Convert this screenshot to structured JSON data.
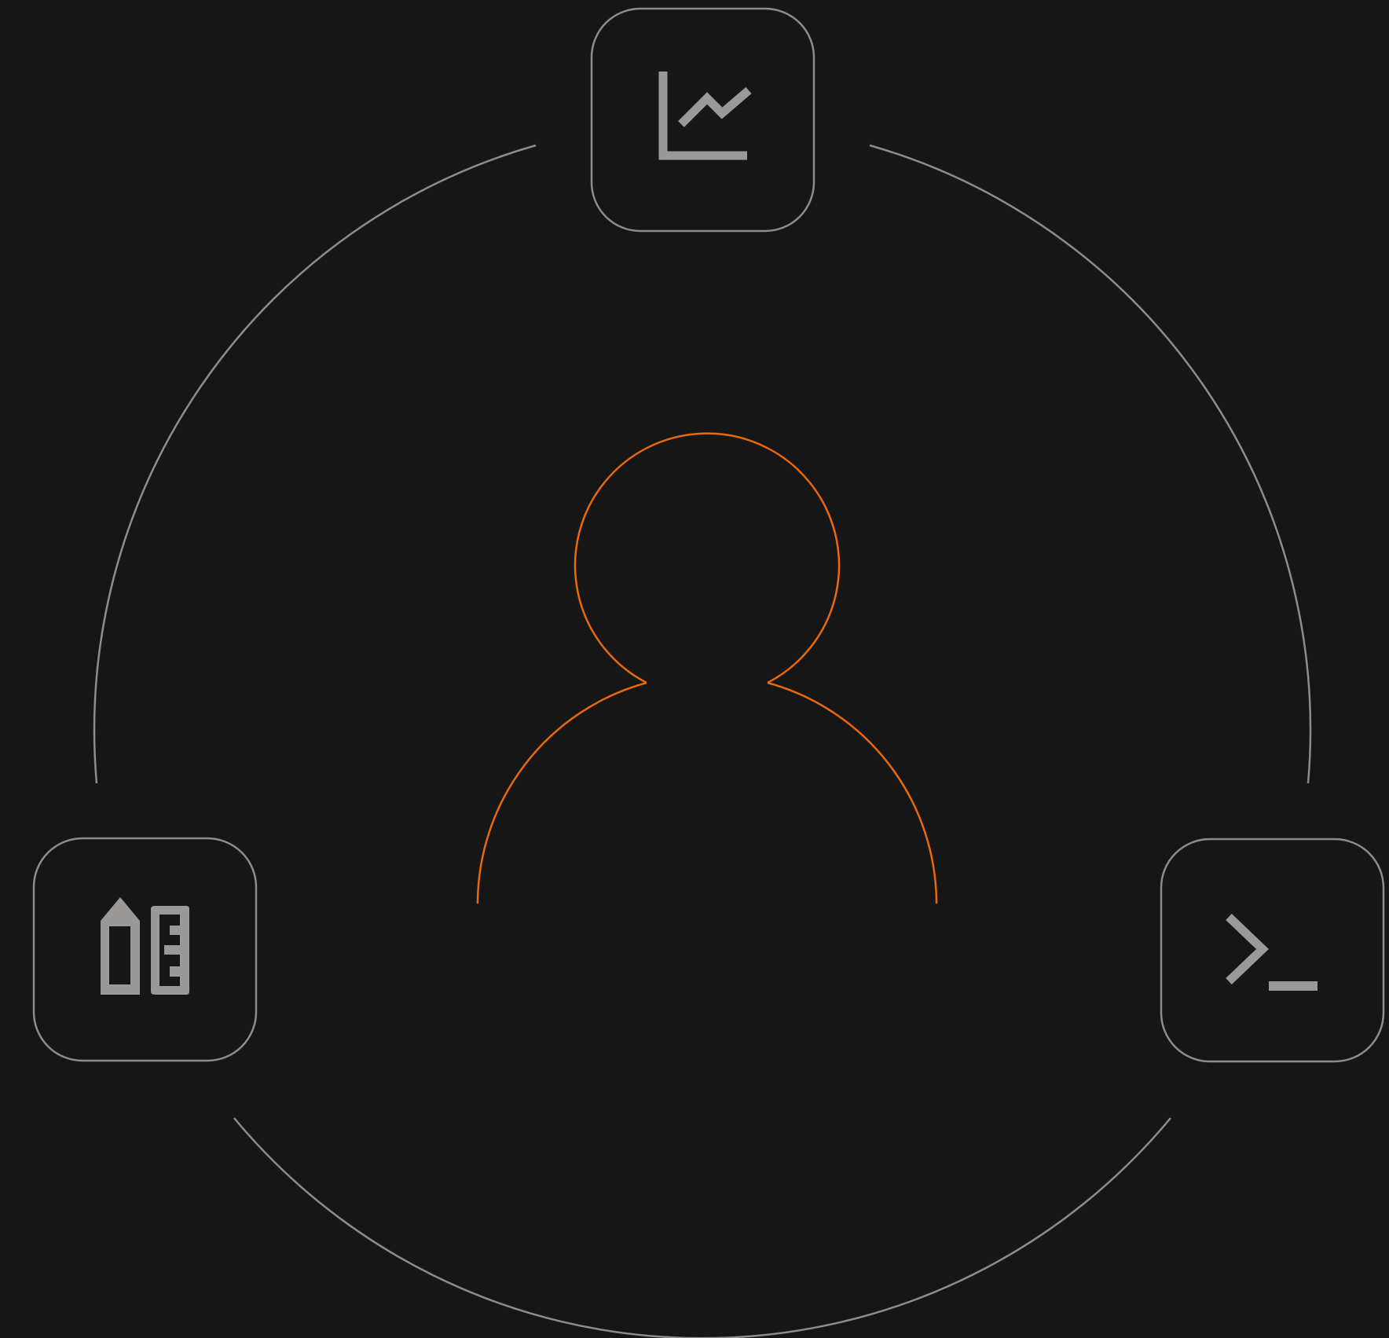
{
  "diagram": {
    "center": {
      "icon": "user-icon"
    },
    "nodes": [
      {
        "id": "analytics",
        "icon": "line-chart-icon"
      },
      {
        "id": "design",
        "icon": "pencil-ruler-icon"
      },
      {
        "id": "terminal",
        "icon": "terminal-icon"
      }
    ]
  },
  "colors": {
    "background": "#171616",
    "ring": "#8f8d8b",
    "icon": "#9b9998",
    "accent": "#e8690d"
  }
}
